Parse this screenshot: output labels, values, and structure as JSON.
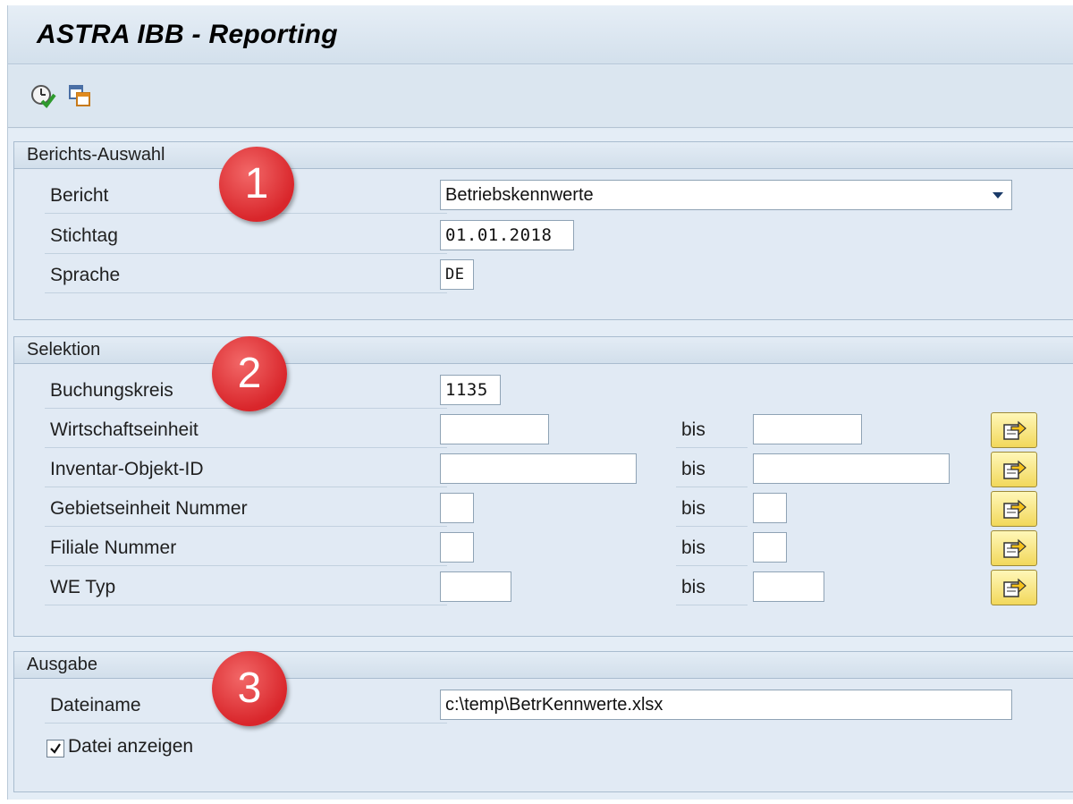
{
  "window": {
    "title": "ASTRA IBB - Reporting"
  },
  "toolbar": {
    "icons": [
      "execute-clock-icon",
      "copy-windows-icon"
    ]
  },
  "berichts_auswahl": {
    "header": "Berichts-Auswahl",
    "badge": "1",
    "bericht": {
      "label": "Bericht",
      "value": "Betriebskennwerte"
    },
    "stichtag": {
      "label": "Stichtag",
      "value": "01.01.2018"
    },
    "sprache": {
      "label": "Sprache",
      "value": "DE"
    }
  },
  "selektion": {
    "header": "Selektion",
    "badge": "2",
    "buchungskreis": {
      "label": "Buchungskreis",
      "value": "1135"
    },
    "rows": [
      {
        "label": "Wirtschaftseinheit",
        "from": "",
        "bis": "bis",
        "to": ""
      },
      {
        "label": "Inventar-Objekt-ID",
        "from": "",
        "bis": "bis",
        "to": ""
      },
      {
        "label": "Gebietseinheit Nummer",
        "from": "",
        "bis": "bis",
        "to": ""
      },
      {
        "label": "Filiale Nummer",
        "from": "",
        "bis": "bis",
        "to": ""
      },
      {
        "label": "WE Typ",
        "from": "",
        "bis": "bis",
        "to": ""
      }
    ]
  },
  "ausgabe": {
    "header": "Ausgabe",
    "badge": "3",
    "dateiname": {
      "label": "Dateiname",
      "value": "c:\\temp\\BetrKennwerte.xlsx"
    },
    "datei_anzeigen": {
      "label": "Datei anzeigen",
      "checked": true
    }
  },
  "colors": {
    "badge_red": "#d9262b",
    "panel_bg": "#e1eaf4",
    "header_bg": "#d2dfeb"
  }
}
